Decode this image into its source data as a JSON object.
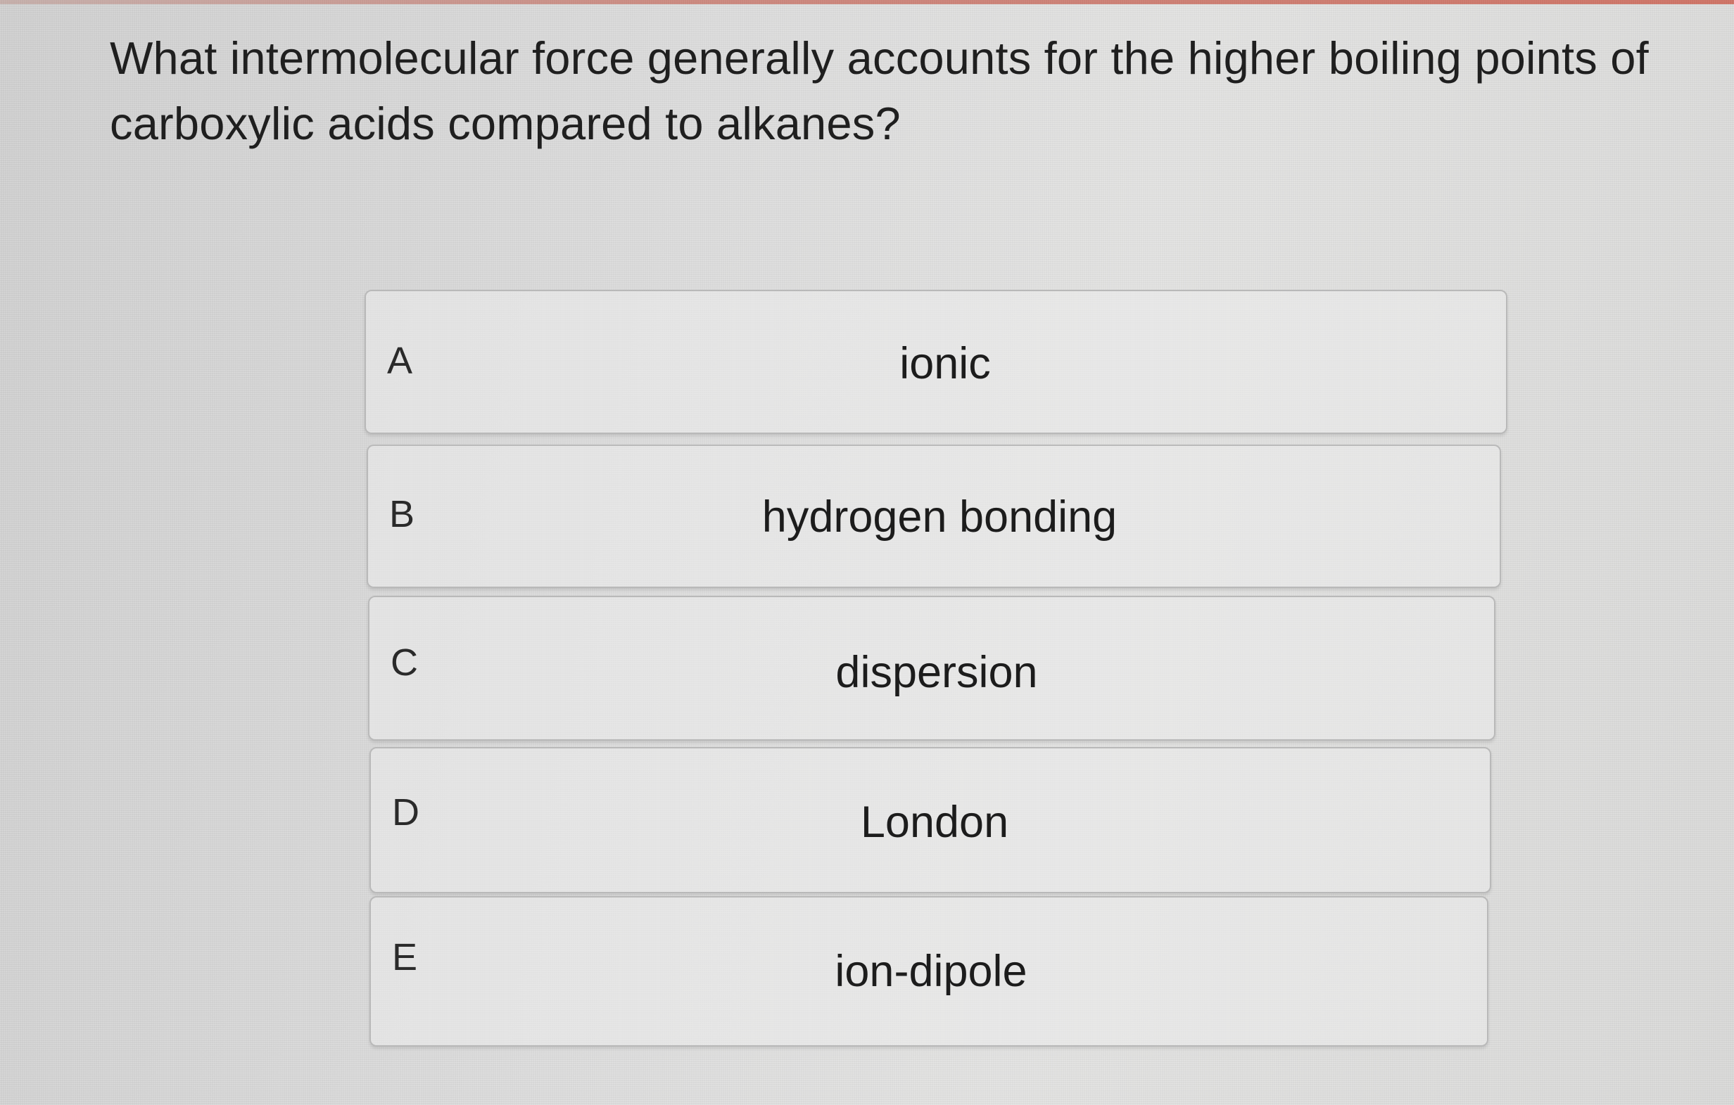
{
  "question": {
    "text": "What intermolecular force generally accounts for the higher boiling points of carboxylic acids compared to alkanes?"
  },
  "options": [
    {
      "letter": "A",
      "text": "ionic"
    },
    {
      "letter": "B",
      "text": "hydrogen bonding"
    },
    {
      "letter": "C",
      "text": "dispersion"
    },
    {
      "letter": "D",
      "text": "London"
    },
    {
      "letter": "E",
      "text": "ion-dipole"
    }
  ],
  "colors": {
    "background": "#dedede",
    "option_background": "#ececec",
    "option_border": "#b9b9b9",
    "text": "#1f1f1f",
    "top_edge_accent": "#d27466"
  }
}
